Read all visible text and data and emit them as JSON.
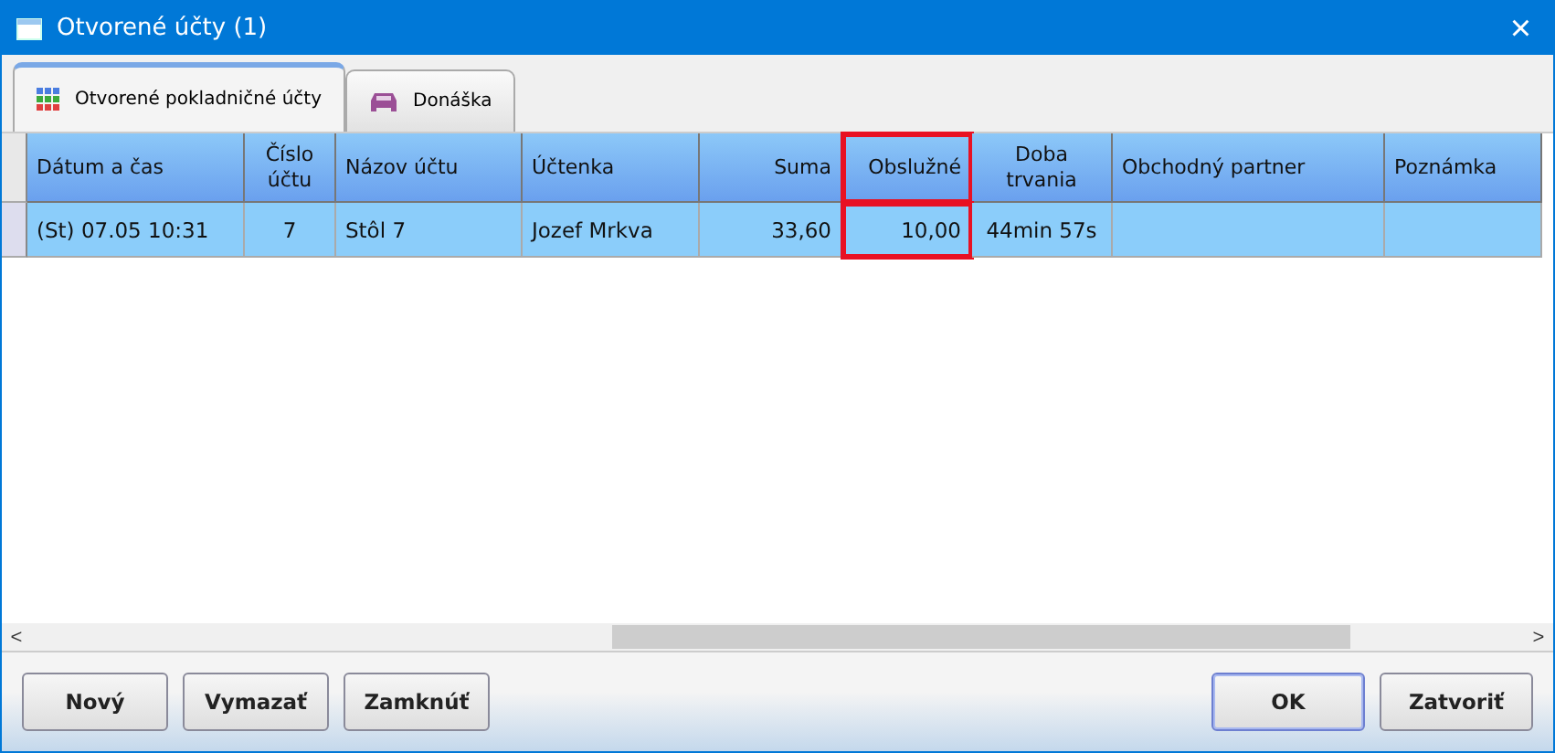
{
  "window": {
    "title": "Otvorené účty (1)",
    "close": "×"
  },
  "tabs": [
    {
      "label": "Otvorené pokladničné účty",
      "selected": true
    },
    {
      "label": "Donáška",
      "selected": false
    }
  ],
  "table": {
    "columns": [
      {
        "label": "Dátum a čas",
        "highlighted": false
      },
      {
        "label": "Číslo účtu",
        "highlighted": false
      },
      {
        "label": "Názov účtu",
        "highlighted": false
      },
      {
        "label": "Účtenka",
        "highlighted": false
      },
      {
        "label": "Suma",
        "highlighted": false
      },
      {
        "label": "Obslužné",
        "highlighted": true
      },
      {
        "label": "Doba trvania",
        "highlighted": false
      },
      {
        "label": "Obchodný partner",
        "highlighted": false
      },
      {
        "label": "Poznámka",
        "highlighted": false
      }
    ],
    "rows": [
      {
        "selected": true,
        "cells": [
          "(St) 07.05 10:31",
          "7",
          "Stôl 7",
          "Jozef Mrkva",
          "33,60",
          "10,00",
          "44min 57s",
          "",
          ""
        ]
      }
    ]
  },
  "scrollbar": {
    "left": "<",
    "right": ">"
  },
  "buttons_left": [
    "Nový",
    "Vymazať",
    "Zamknúť"
  ],
  "buttons_right": [
    {
      "label": "OK",
      "default": true
    },
    {
      "label": "Zatvoriť",
      "default": false
    }
  ]
}
